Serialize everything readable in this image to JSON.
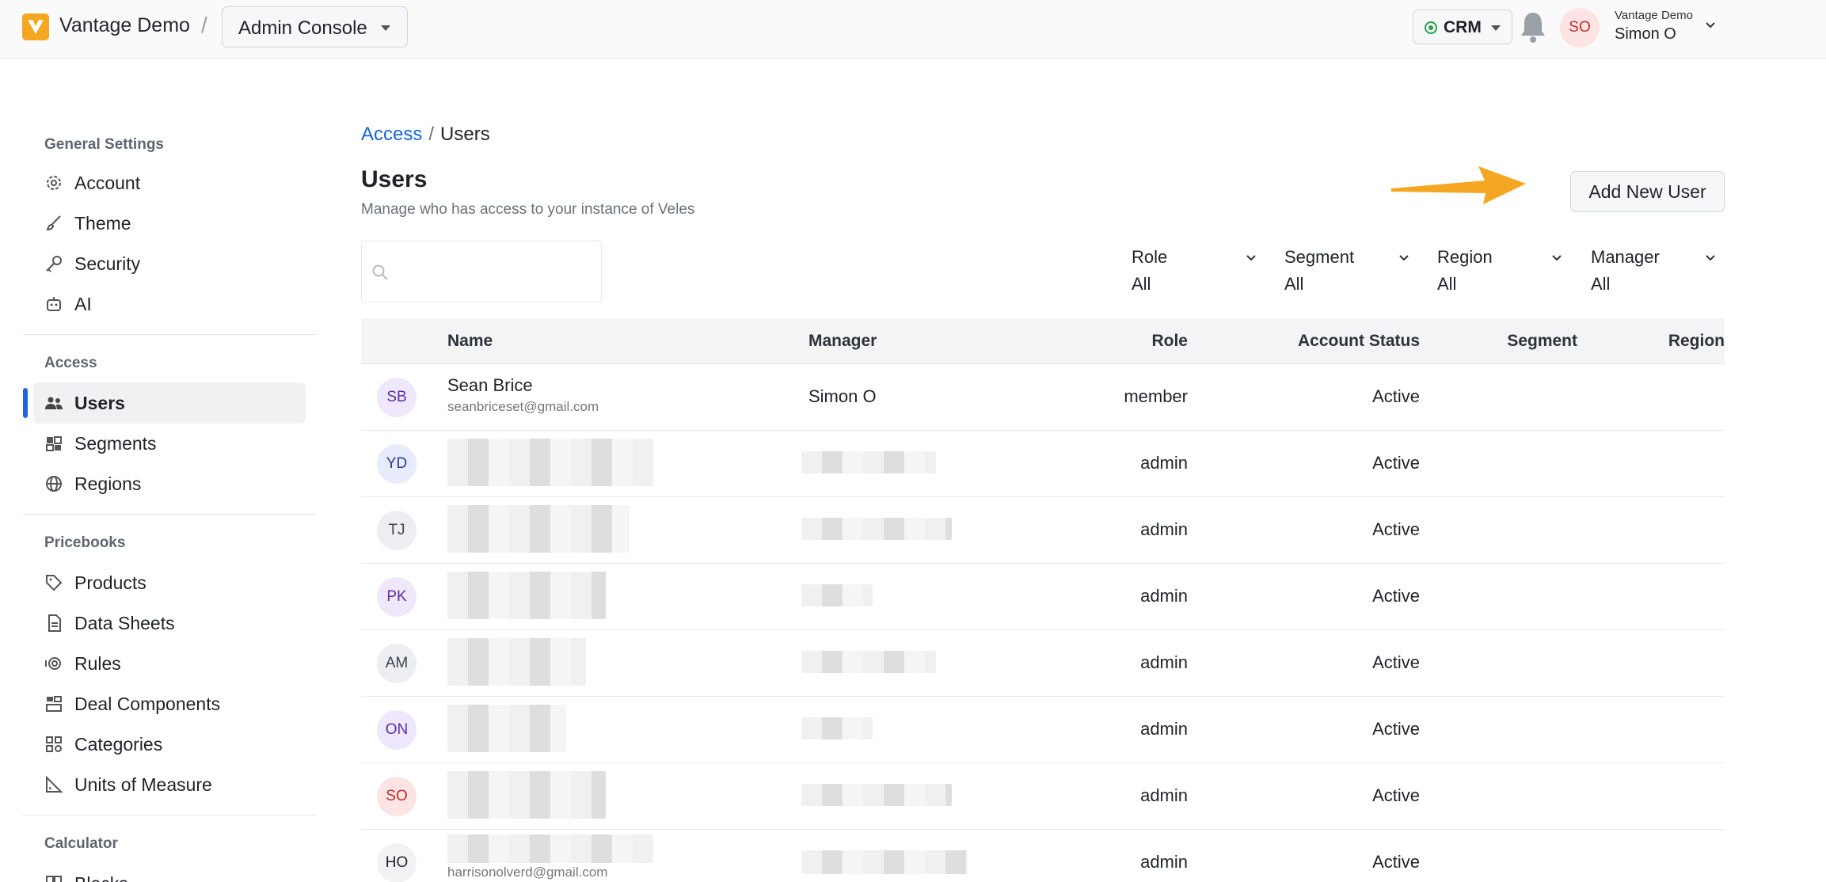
{
  "header": {
    "org_name": "Vantage Demo",
    "console_select": "Admin Console",
    "crm_select": "CRM",
    "user": {
      "initials": "SO",
      "org": "Vantage Demo",
      "name": "Simon O"
    }
  },
  "sidebar": {
    "sections": [
      {
        "title": "General Settings",
        "items": [
          {
            "label": "Account",
            "icon": "gear-icon"
          },
          {
            "label": "Theme",
            "icon": "brush-icon"
          },
          {
            "label": "Security",
            "icon": "key-icon"
          },
          {
            "label": "AI",
            "icon": "robot-icon"
          }
        ]
      },
      {
        "title": "Access",
        "items": [
          {
            "label": "Users",
            "icon": "users-icon",
            "active": true
          },
          {
            "label": "Segments",
            "icon": "segments-icon"
          },
          {
            "label": "Regions",
            "icon": "globe-icon"
          }
        ]
      },
      {
        "title": "Pricebooks",
        "items": [
          {
            "label": "Products",
            "icon": "tag-icon"
          },
          {
            "label": "Data Sheets",
            "icon": "document-icon"
          },
          {
            "label": "Rules",
            "icon": "rules-icon"
          },
          {
            "label": "Deal Components",
            "icon": "components-icon"
          },
          {
            "label": "Categories",
            "icon": "categories-icon"
          },
          {
            "label": "Units of Measure",
            "icon": "ruler-icon"
          }
        ]
      },
      {
        "title": "Calculator",
        "items": [
          {
            "label": "Blocks",
            "icon": "blocks-icon"
          }
        ]
      }
    ]
  },
  "main": {
    "breadcrumb": {
      "parent": "Access",
      "separator": "/",
      "current": "Users"
    },
    "title": "Users",
    "subtitle": "Manage who has access to your instance of Veles",
    "add_button": "Add New User",
    "search": {
      "placeholder": ""
    },
    "filters": [
      {
        "label": "Role",
        "value": "All"
      },
      {
        "label": "Segment",
        "value": "All"
      },
      {
        "label": "Region",
        "value": "All"
      },
      {
        "label": "Manager",
        "value": "All"
      }
    ],
    "columns": [
      "Name",
      "Manager",
      "Role",
      "Account Status",
      "Segment",
      "Region"
    ],
    "rows": [
      {
        "initials": "SB",
        "name": "Sean Brice",
        "email": "seanbriceset@gmail.com",
        "manager": "Simon O",
        "role": "member",
        "status": "Active"
      },
      {
        "initials": "YD",
        "name": "",
        "email": "",
        "manager": "",
        "role": "admin",
        "status": "Active"
      },
      {
        "initials": "TJ",
        "name": "",
        "email": "",
        "manager": "",
        "role": "admin",
        "status": "Active"
      },
      {
        "initials": "PK",
        "name": "",
        "email": "",
        "manager": "",
        "role": "admin",
        "status": "Active"
      },
      {
        "initials": "AM",
        "name": "",
        "email": "",
        "manager": "",
        "role": "admin",
        "status": "Active"
      },
      {
        "initials": "ON",
        "name": "",
        "email": "",
        "manager": "",
        "role": "admin",
        "status": "Active"
      },
      {
        "initials": "SO",
        "name": "",
        "email": "",
        "manager": "",
        "role": "admin",
        "status": "Active"
      },
      {
        "initials": "HO",
        "name": "",
        "email": "harrisonolverd@gmail.com",
        "manager": "",
        "role": "admin",
        "status": "Active"
      }
    ]
  },
  "colors": {
    "accent": "#1f63e0",
    "link": "#1764d6",
    "logo": "#f5a623",
    "arrow": "#f5a623",
    "crm_status": "#26a148"
  }
}
